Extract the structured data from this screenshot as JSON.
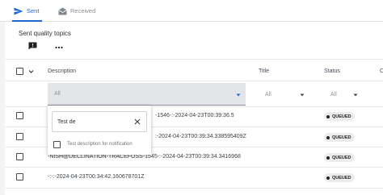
{
  "tabs": [
    {
      "label": "Sent",
      "icon": "send-icon",
      "active": true
    },
    {
      "label": "Received",
      "icon": "inbox-icon",
      "active": false
    }
  ],
  "card": {
    "title": "Sent quality topics"
  },
  "columns": {
    "description": "Description",
    "title": "Title",
    "status": "Status",
    "overflow": "C"
  },
  "filters": {
    "description": "All",
    "title": "All",
    "status": "All"
  },
  "dropdown": {
    "search_value": "Test de",
    "option_label": "Test description for notification"
  },
  "rows": [
    {
      "description": "-1546-:-2024-04-23T00:39:36.5",
      "status": "QUEUED"
    },
    {
      "description": ":-2024-04-23T00:39:34.338595409Z",
      "status": "QUEUED"
    },
    {
      "description": "-NISH@DECLINATION-TRACEFOSS-1545-:-2024-04-23T00:39:34.3416968",
      "status": "QUEUED"
    },
    {
      "description": "-:-:-2024-04-23T00:34:42.160678701Z",
      "status": "QUEUED"
    }
  ],
  "colors": {
    "accent": "#1d67d6",
    "filter_bg": "#e3e5e8",
    "badge_bg": "#ececee"
  }
}
